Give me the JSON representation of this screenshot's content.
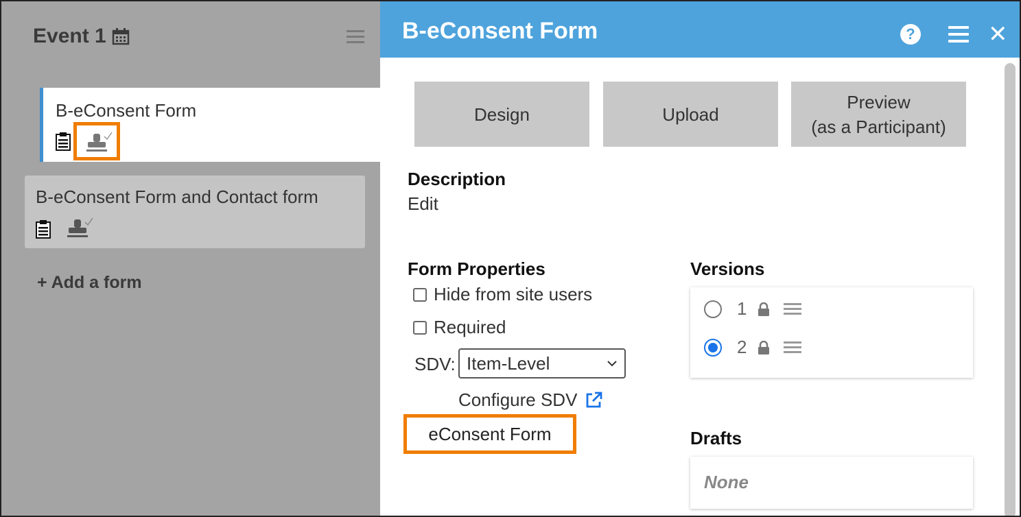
{
  "left_panel": {
    "event_title": "Event 1",
    "forms": [
      {
        "title": "B-eConsent Form"
      },
      {
        "title": "B-eConsent Form and Contact form"
      }
    ],
    "add_form_label": "+ Add a form"
  },
  "right_panel": {
    "title": "B-eConsent Form",
    "buttons": {
      "design": "Design",
      "upload": "Upload",
      "preview_line1": "Preview",
      "preview_line2": "(as a Participant)"
    },
    "description": {
      "label": "Description",
      "edit": "Edit"
    },
    "form_properties": {
      "label": "Form Properties",
      "hide_from_site_users": "Hide from site users",
      "required": "Required",
      "sdv_label": "SDV:",
      "sdv_value": "Item-Level",
      "configure_sdv": "Configure SDV",
      "econsent_form": "eConsent Form"
    },
    "versions": {
      "label": "Versions",
      "items": [
        {
          "number": "1",
          "selected": false
        },
        {
          "number": "2",
          "selected": true
        }
      ]
    },
    "drafts": {
      "label": "Drafts",
      "value": "None"
    }
  },
  "colors": {
    "header_blue": "#4ea3dc",
    "highlight_orange": "#f07d00",
    "radio_blue": "#1a73e8"
  }
}
